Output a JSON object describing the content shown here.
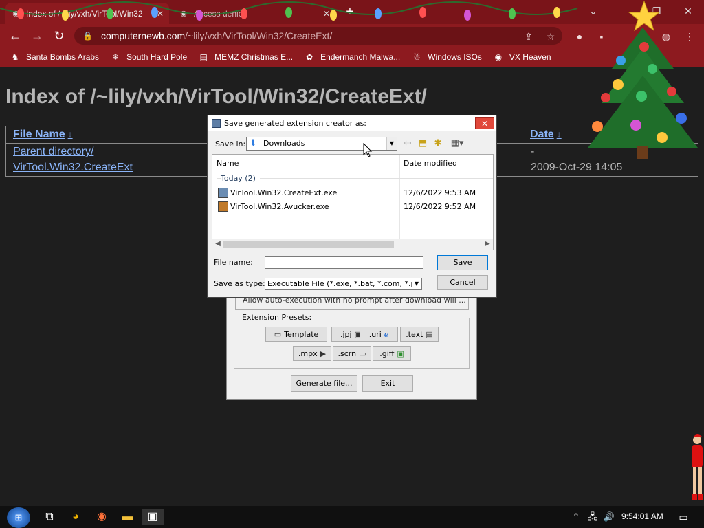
{
  "browser": {
    "tabs": [
      {
        "title": "Index of /~lily/vxh/VirTool/Win32",
        "close": "✕",
        "active": true
      },
      {
        "title": "Access denied",
        "close": "✕",
        "active": false
      }
    ],
    "new_tab": "+",
    "url_host": "computernewb.com",
    "url_path": "/~lily/vxh/VirTool/Win32/CreateExt/",
    "bookmarks": [
      {
        "label": "Santa Bombs Arabs",
        "icon": "sleigh-icon"
      },
      {
        "label": "South Hard Pole",
        "icon": "snowflake-icon"
      },
      {
        "label": "MEMZ Christmas E...",
        "icon": "page-icon"
      },
      {
        "label": "Endermanch Malwa...",
        "icon": "cat-icon"
      },
      {
        "label": "Windows ISOs",
        "icon": "gingerbread-icon"
      },
      {
        "label": "VX Heaven",
        "icon": "disk-icon"
      }
    ]
  },
  "page": {
    "heading": "Index of /~lily/vxh/VirTool/Win32/CreateExt/",
    "col_filename": "File Name",
    "col_date": "Date",
    "sort_arrow": "↓",
    "rows": [
      {
        "name": "Parent directory/",
        "date": "-"
      },
      {
        "name": "VirTool.Win32.CreateExt",
        "date": "2009-Oct-29 14:05"
      }
    ]
  },
  "tool_window": {
    "partial_checkbox_text": "Allow auto-execution with no prompt after download will ...",
    "presets_legend": "Extension Presets:",
    "presets": [
      {
        "label": "Template",
        "icon": "window-icon"
      },
      {
        "label": ".jpj",
        "icon": "image-icon"
      },
      {
        "label": ".uri",
        "icon": "ie-icon"
      },
      {
        "label": ".text",
        "icon": "notepad-icon"
      },
      {
        "label": ".mpx",
        "icon": "media-icon"
      },
      {
        "label": ".scrn",
        "icon": "monitor-icon"
      },
      {
        "label": ".giff",
        "icon": "paint-icon"
      }
    ],
    "generate_label": "Generate file...",
    "exit_label": "Exit"
  },
  "dialog": {
    "title": "Save generated extension creator as:",
    "close": "✕",
    "save_in_label": "Save in:",
    "save_in_value": "Downloads",
    "col_name": "Name",
    "col_date_modified": "Date modified",
    "group": "Today (2)",
    "files": [
      {
        "name": "VirTool.Win32.CreateExt.exe",
        "date": "12/6/2022 9:53 AM"
      },
      {
        "name": "VirTool.Win32.Avucker.exe",
        "date": "12/6/2022 9:52 AM"
      }
    ],
    "filename_label": "File name:",
    "filename_value": "",
    "savetype_label": "Save as type:",
    "savetype_value": "Executable File (*.exe, *.bat, *.com, *.pif, *.sc",
    "save_button": "Save",
    "cancel_button": "Cancel"
  },
  "taskbar": {
    "time": "9:54:01 AM"
  },
  "colors": {
    "browser_chrome": "#8d1a1f",
    "page_bg": "#1e1e1e",
    "link": "#8ab4f8",
    "dialog_close": "#e0483b"
  }
}
